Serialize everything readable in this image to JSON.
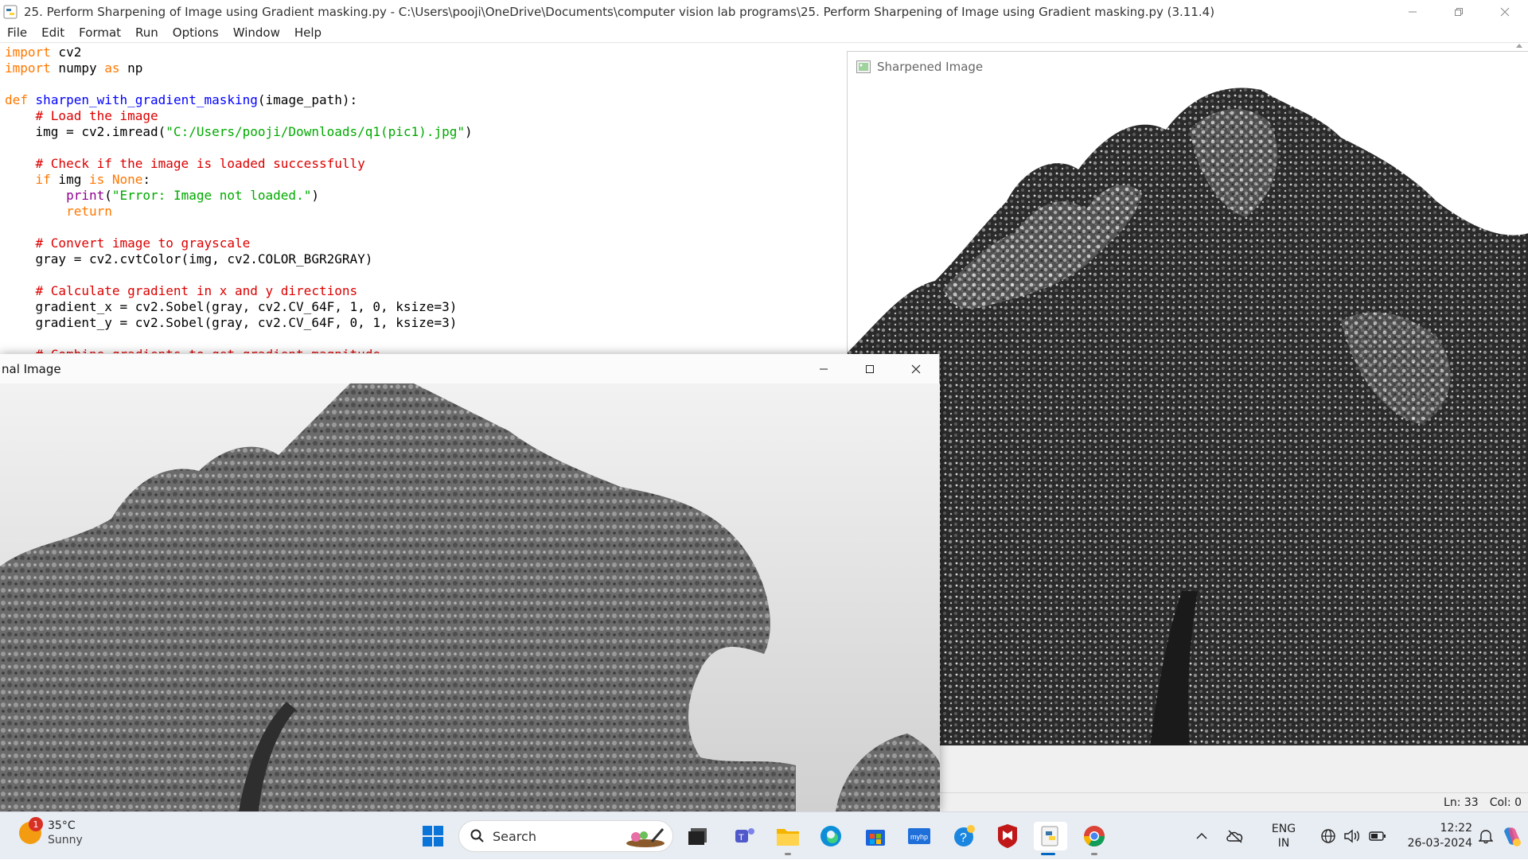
{
  "idle": {
    "title": "25. Perform Sharpening of Image using Gradient masking.py - C:\\Users\\pooji\\OneDrive\\Documents\\computer vision lab programs\\25. Perform Sharpening of Image using Gradient masking.py (3.11.4)",
    "menu": [
      "File",
      "Edit",
      "Format",
      "Run",
      "Options",
      "Window",
      "Help"
    ],
    "status": {
      "line": "Ln: 33",
      "col": "Col: 0"
    }
  },
  "code_lines": [
    "import cv2",
    "import numpy as np",
    "",
    "def sharpen_with_gradient_masking(image_path):",
    "    # Load the image",
    "    img = cv2.imread(\"C:/Users/pooji/Downloads/q1(pic1).jpg\")",
    "",
    "    # Check if the image is loaded successfully",
    "    if img is None:",
    "        print(\"Error: Image not loaded.\")",
    "        return",
    "",
    "    # Convert image to grayscale",
    "    gray = cv2.cvtColor(img, cv2.COLOR_BGR2GRAY)",
    "",
    "    # Calculate gradient in x and y directions",
    "    gradient_x = cv2.Sobel(gray, cv2.CV_64F, 1, 0, ksize=3)",
    "    gradient_y = cv2.Sobel(gray, cv2.CV_64F, 0, 1, ksize=3)",
    "",
    "    # Combine gradients to get gradient magnitude"
  ],
  "sharpened_window": {
    "title": "Sharpened Image"
  },
  "original_window": {
    "title": "nal Image"
  },
  "taskbar": {
    "weather": {
      "temp": "35°C",
      "condition": "Sunny",
      "badge": "1"
    },
    "search_label": "Search",
    "apps": [
      "start-icon",
      "file-explorer-dark-icon",
      "teams-icon",
      "folder-icon",
      "edge-icon",
      "store-icon",
      "myhp-icon",
      "help-icon",
      "mcafee-icon",
      "python-idle-icon",
      "chrome-icon"
    ],
    "lang": {
      "line1": "ENG",
      "line2": "IN"
    },
    "clock": {
      "time": "12:22",
      "date": "26-03-2024"
    }
  },
  "colors": {
    "keyword": "#ff7700",
    "function_def": "#0000ff",
    "builtin": "#900090",
    "string": "#00aa00",
    "comment": "#dd0000"
  }
}
